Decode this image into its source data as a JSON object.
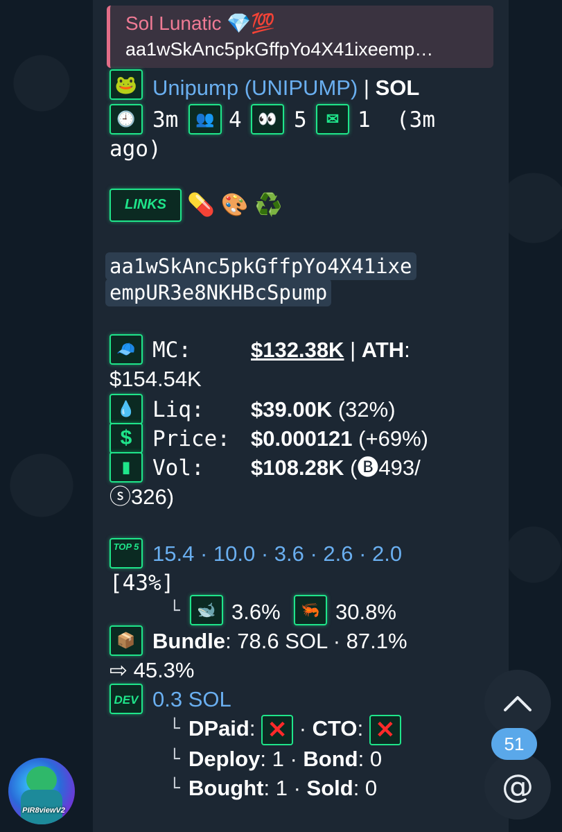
{
  "reply": {
    "name": "Sol Lunatic 💎💯",
    "text": "aa1wSkAnc5pkGffpYo4X41ixeemp…"
  },
  "token": {
    "name": "Unipump (UNIPUMP)",
    "chain_sep": " | ",
    "chain": "SOL"
  },
  "stats": {
    "age": "3m",
    "holders": "4",
    "watchers": "5",
    "messages": "1",
    "last_msg_a": "(3m",
    "last_msg_b": "ago)"
  },
  "links_label": "LINKS",
  "link_emojis": "💊 🎨 ♻️",
  "contract": {
    "line1": "aa1wSkAnc5pkGffpYo4X41ixe",
    "line2": "empUR3e8NKHBcSpump"
  },
  "market": {
    "mc_label": "MC:",
    "mc_value": "$132.38K",
    "ath_sep": " | ",
    "ath_label": "ATH",
    "ath_colon": ":",
    "ath_value": "$154.54K",
    "liq_label": "Liq:",
    "liq_value": "$39.00K",
    "liq_pct": " (32%)",
    "price_label": "Price:",
    "price_value": "$0.000121",
    "price_change": " (+69%)",
    "vol_label": "Vol:",
    "vol_value": "$108.28K",
    "vol_split_a": " (🅑493/",
    "vol_split_b": "ⓢ326)"
  },
  "top5": {
    "icon": "TOP 5",
    "values": "15.4 · 10.0 · 3.6 · 2.6 · 2.0",
    "total": "[43%]",
    "branch": "└",
    "whale_pct": "3.6%",
    "shrimp_pct": "30.8%"
  },
  "bundle": {
    "label": "Bundle",
    "colon": ":",
    "value": " 78.6 SOL · 87.1%",
    "arrow_value": "⇨ 45.3%"
  },
  "dev": {
    "icon": "DEV",
    "value": "0.3 SOL",
    "dpaid_label": "DPaid",
    "cto_label": "CTO",
    "deploy_label": "Deploy",
    "deploy_value": " 1",
    "bond_label": "Bond",
    "bond_value": " 0",
    "bought_label": "Bought",
    "bought_value": " 1",
    "sold_label": "Sold",
    "sold_value": " 0",
    "sep": " · ",
    "colon": ":",
    "branch": "└"
  },
  "avatar_text": "PIR8viewV2",
  "unread_count": "51",
  "colors": {
    "accent_green": "#1fe58a",
    "link_blue": "#6aaff0",
    "reply_pink": "#f07b95",
    "badge_blue": "#5aa8ea"
  }
}
